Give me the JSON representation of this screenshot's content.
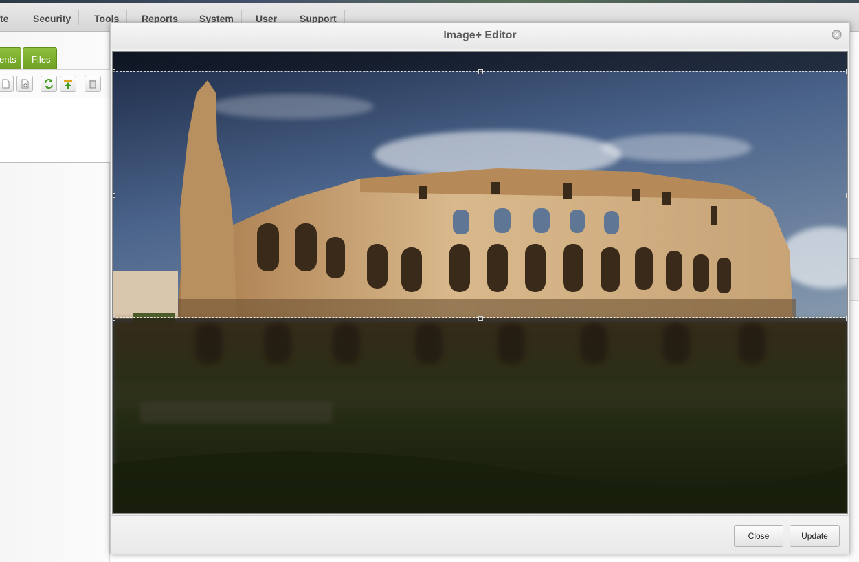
{
  "menubar": {
    "items": [
      "te",
      "Security",
      "Tools",
      "Reports",
      "System",
      "User",
      "Support"
    ]
  },
  "left_panel": {
    "tabs": [
      "ents",
      "Files"
    ],
    "toolbar_icons": [
      "new-file-icon",
      "settings-file-icon",
      "refresh-icon",
      "upload-icon",
      "trash-icon"
    ]
  },
  "dialog": {
    "title": "Image+ Editor",
    "close_icon": "close-circle-icon",
    "buttons": {
      "close": "Close",
      "update": "Update"
    }
  },
  "image_editor": {
    "subject": "Colosseum",
    "crop_region": {
      "top": 0.043,
      "bottom": 0.576,
      "left": 0.0,
      "right": 1.0
    }
  },
  "colors": {
    "tab_green": "#7cad2e",
    "menubar": "#dedede",
    "sky": "#4f6889",
    "stone": "#c9a77a",
    "grass": "#3f5a22"
  }
}
